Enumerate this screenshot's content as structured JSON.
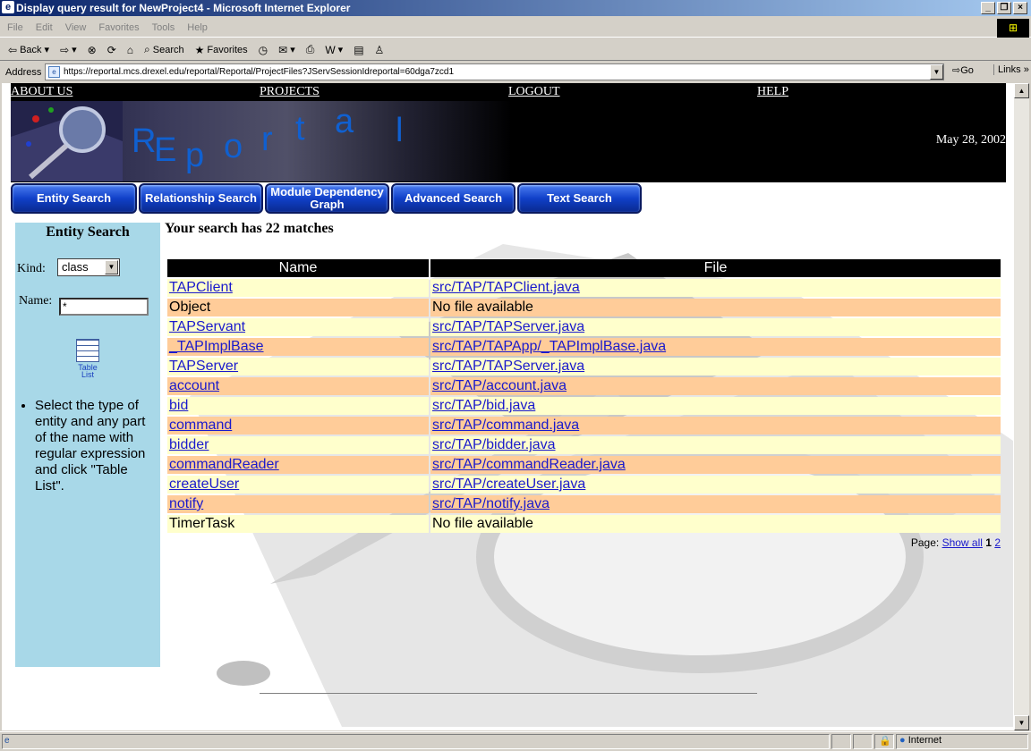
{
  "window": {
    "title": "Display query result for NewProject4 - Microsoft Internet Explorer"
  },
  "menu": [
    "File",
    "Edit",
    "View",
    "Favorites",
    "Tools",
    "Help"
  ],
  "toolbar": {
    "back": "Back",
    "search": "Search",
    "favorites": "Favorites"
  },
  "address": {
    "label": "Address",
    "url": "https://reportal.mcs.drexel.edu/reportal/Reportal/ProjectFiles?JServSessionIdreportal=60dga7zcd1",
    "go": "Go",
    "links": "Links"
  },
  "page": {
    "toplinks": [
      "ABOUT US",
      "PROJECTS",
      "LOGOUT",
      "HELP"
    ],
    "logo_text": "REportal",
    "date": "May 28, 2002",
    "nav": [
      "Entity Search",
      "Relationship Search",
      "Module Dependency Graph",
      "Advanced Search",
      "Text Search"
    ],
    "sidebar": {
      "title": "Entity Search",
      "kind_label": "Kind:",
      "kind_value": "class",
      "name_label": "Name:",
      "name_value": "*",
      "table_list": "Table List",
      "help": "Select the type of entity and any part of the name with regular expression and click \"Table List\"."
    },
    "matches": "Your search has 22 matches",
    "table": {
      "headers": [
        "Name",
        "File"
      ],
      "rows": [
        [
          "TAPClient",
          "src/TAP/TAPClient.java"
        ],
        [
          "Object",
          "No file available"
        ],
        [
          "TAPServant",
          "src/TAP/TAPServer.java"
        ],
        [
          "_TAPImplBase",
          "src/TAP/TAPApp/_TAPImplBase.java"
        ],
        [
          "TAPServer",
          "src/TAP/TAPServer.java"
        ],
        [
          "account",
          "src/TAP/account.java"
        ],
        [
          "bid",
          "src/TAP/bid.java"
        ],
        [
          "command",
          "src/TAP/command.java"
        ],
        [
          "bidder",
          "src/TAP/bidder.java"
        ],
        [
          "commandReader",
          "src/TAP/commandReader.java"
        ],
        [
          "createUser",
          "src/TAP/createUser.java"
        ],
        [
          "notify",
          "src/TAP/notify.java"
        ],
        [
          "TimerTask",
          "No file available"
        ]
      ]
    },
    "pager": {
      "label": "Page:",
      "show_all": "Show all",
      "current": "1",
      "next": "2"
    }
  },
  "status": {
    "zone": "Internet"
  }
}
